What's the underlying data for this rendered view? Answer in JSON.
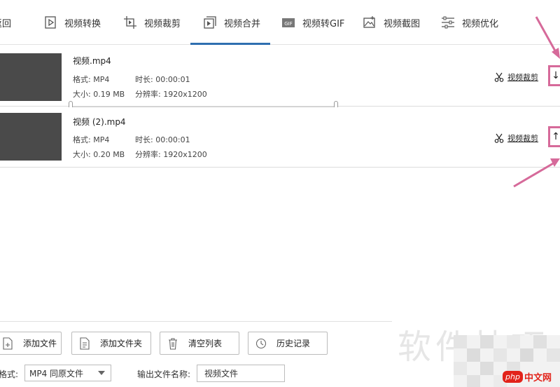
{
  "tabs": {
    "back": "返回",
    "items": [
      {
        "label": "视频转换",
        "icon": "play-file-icon"
      },
      {
        "label": "视频裁剪",
        "icon": "crop-icon"
      },
      {
        "label": "视频合并",
        "icon": "merge-icon",
        "active": true
      },
      {
        "label": "视频转GIF",
        "icon": "gif-icon"
      },
      {
        "label": "视频截图",
        "icon": "image-icon"
      },
      {
        "label": "视频优化",
        "icon": "sliders-icon"
      }
    ]
  },
  "files": [
    {
      "name": "视频.mp4",
      "format": "格式: MP4",
      "duration": "时长: 00:00:01",
      "size": "大小: 0.19 MB",
      "resolution": "分辨率: 1920x1200",
      "cut_label": "视频裁剪",
      "move": "↓"
    },
    {
      "name": "视频 (2).mp4",
      "format": "格式: MP4",
      "duration": "时长: 00:00:01",
      "size": "大小: 0.20 MB",
      "resolution": "分辨率: 1920x1200",
      "cut_label": "视频裁剪",
      "move": "↑"
    }
  ],
  "buttons": {
    "add_file": "添加文件",
    "add_folder": "添加文件夹",
    "clear_list": "清空列表",
    "history": "历史记录"
  },
  "output": {
    "format_label": "格式:",
    "format_value": "MP4 同原文件",
    "name_label": "输出文件名称:",
    "name_value": "视频文件"
  },
  "watermark": {
    "text": "软件技巧",
    "logo_php": "php",
    "logo_cn": "中文网"
  },
  "colors": {
    "accent": "#2f6fb0",
    "highlight": "#d66a9a",
    "thumb": "#4a4a4a"
  }
}
